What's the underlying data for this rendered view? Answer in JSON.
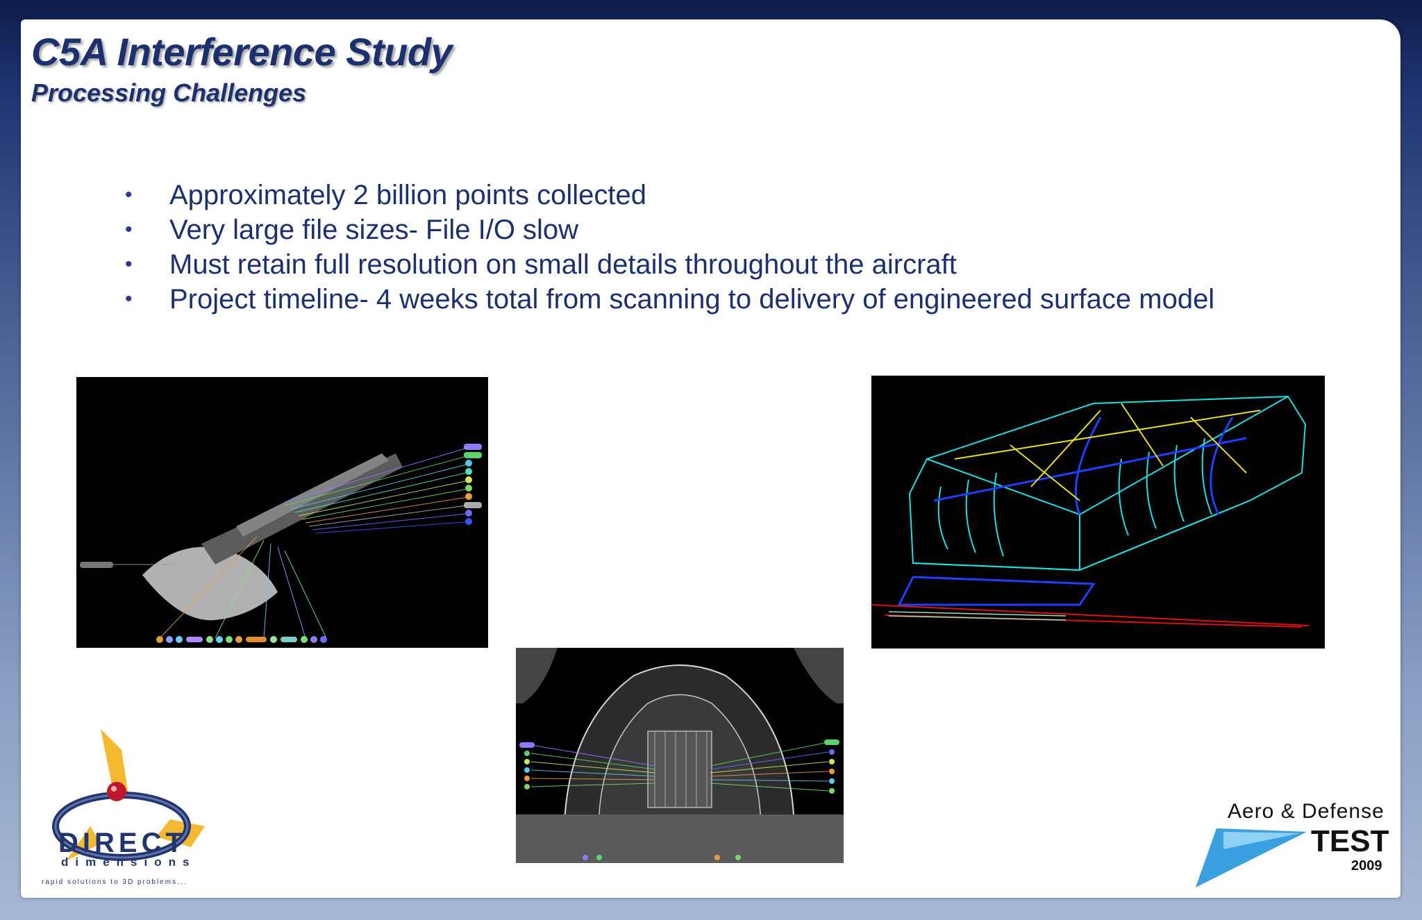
{
  "slide": {
    "title": "C5A Interference Study",
    "subtitle": "Processing Challenges",
    "bullet_glyph": "•",
    "bullets": [
      "Approximately 2 billion points collected",
      "Very large file sizes- File I/O slow",
      "Must retain full resolution on small details throughout the aircraft",
      "Project timeline- 4 weeks total from scanning to delivery of engineered surface model"
    ]
  },
  "images": {
    "left": "point-cloud-scan-overview",
    "center": "cargo-bay-interior-scan",
    "right": "engineered-surface-wireframe"
  },
  "logos": {
    "direct_dimensions": {
      "name": "DIRECT",
      "sub": "dimensions",
      "tagline": "rapid solutions to 3D problems...",
      "colors": {
        "blue": "#23356f",
        "yellow": "#f2b21b",
        "red": "#c0182a"
      }
    },
    "aero_defense": {
      "top": "Aero & Defense",
      "test": "TEST",
      "year": "2009",
      "colors": {
        "blue": "#3aa0e0"
      }
    }
  },
  "colors": {
    "title": "#1c2f6e",
    "background_top": "#0e1c4a",
    "background_bottom": "#a7b8d4"
  }
}
